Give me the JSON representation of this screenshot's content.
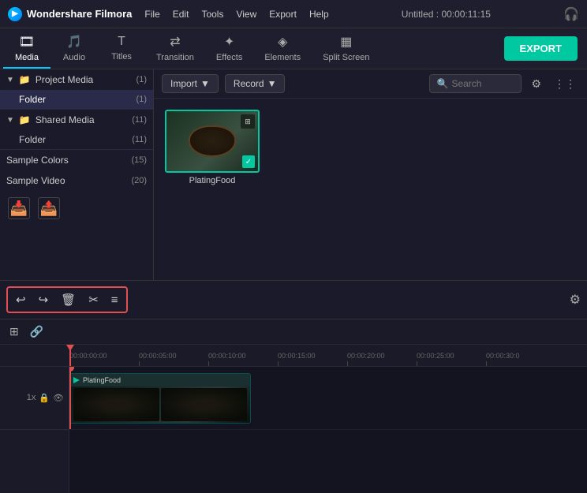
{
  "app": {
    "name": "Wondershare Filmora",
    "title": "Untitled : 00:00:11:15"
  },
  "menu": {
    "items": [
      "File",
      "Edit",
      "Tools",
      "View",
      "Export",
      "Help"
    ]
  },
  "nav_tabs": {
    "tabs": [
      {
        "label": "Media",
        "icon": "🎞",
        "active": true
      },
      {
        "label": "Audio",
        "icon": "♪",
        "active": false
      },
      {
        "label": "Titles",
        "icon": "T",
        "active": false
      },
      {
        "label": "Transition",
        "icon": "⇄",
        "active": false
      },
      {
        "label": "Effects",
        "icon": "✦",
        "active": false
      },
      {
        "label": "Elements",
        "icon": "◈",
        "active": false
      },
      {
        "label": "Split Screen",
        "icon": "▦",
        "active": false
      }
    ],
    "export_label": "EXPORT"
  },
  "sidebar": {
    "sections": [
      {
        "name": "Project Media",
        "count": 1,
        "expanded": true,
        "items": [
          {
            "name": "Folder",
            "count": 1,
            "active": true
          }
        ]
      },
      {
        "name": "Shared Media",
        "count": 11,
        "expanded": true,
        "items": [
          {
            "name": "Folder",
            "count": 11,
            "active": false
          }
        ]
      }
    ],
    "plain_items": [
      {
        "name": "Sample Colors",
        "count": 15
      },
      {
        "name": "Sample Video",
        "count": 20
      }
    ],
    "import_btn": "📥",
    "export_btn": "📤"
  },
  "media_toolbar": {
    "import_label": "Import",
    "record_label": "Record",
    "search_placeholder": "Search"
  },
  "media_items": [
    {
      "name": "PlatingFood",
      "has_check": true
    }
  ],
  "toolbar": {
    "buttons": [
      {
        "icon": "↩",
        "name": "undo"
      },
      {
        "icon": "↪",
        "name": "redo"
      },
      {
        "icon": "🗑",
        "name": "delete"
      },
      {
        "icon": "✂",
        "name": "cut"
      },
      {
        "icon": "≡",
        "name": "adjust"
      }
    ]
  },
  "timeline": {
    "ruler_marks": [
      "00:00:00:00",
      "00:00:05:00",
      "00:00:10:00",
      "00:00:15:00",
      "00:00:20:00",
      "00:00:25:00",
      "00:00:30:0"
    ],
    "track": {
      "clip_name": "PlatingFood",
      "speed_label": "1x",
      "lock_icon": "🔒",
      "visible_icon": "👁"
    }
  },
  "colors": {
    "accent": "#00c8a0",
    "danger": "#e05050",
    "highlight": "#00c8ff"
  }
}
